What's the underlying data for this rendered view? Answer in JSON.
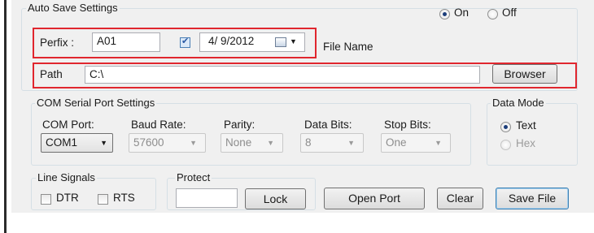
{
  "auto_save": {
    "title": "Auto Save Settings",
    "on_label": "On",
    "off_label": "Off",
    "on_selected": true,
    "prefix_label": "Perfix :",
    "prefix_value": "A01",
    "date_checked": true,
    "date_value": "4/ 9/2012",
    "file_name_label": "File Name",
    "path_label": "Path",
    "path_value": "C:\\",
    "browser_button": "Browser"
  },
  "com_settings": {
    "title": "COM Serial Port Settings",
    "com_port_label": "COM Port:",
    "com_port_value": "COM1",
    "baud_rate_label": "Baud Rate:",
    "baud_rate_value": "57600",
    "parity_label": "Parity:",
    "parity_value": "None",
    "data_bits_label": "Data Bits:",
    "data_bits_value": "8",
    "stop_bits_label": "Stop Bits:",
    "stop_bits_value": "One"
  },
  "data_mode": {
    "title": "Data Mode",
    "text_label": "Text",
    "hex_label": "Hex",
    "selected": "Text"
  },
  "line_signals": {
    "title": "Line Signals",
    "dtr_label": "DTR",
    "rts_label": "RTS"
  },
  "protect": {
    "title": "Protect",
    "password_value": "",
    "lock_button": "Lock"
  },
  "actions": {
    "open_port_button": "Open Port",
    "clear_button": "Clear",
    "save_file_button": "Save File"
  },
  "colors": {
    "panel": "#f0f0f0",
    "highlight_red": "#e0262e",
    "group_border": "#d5dfe5"
  }
}
